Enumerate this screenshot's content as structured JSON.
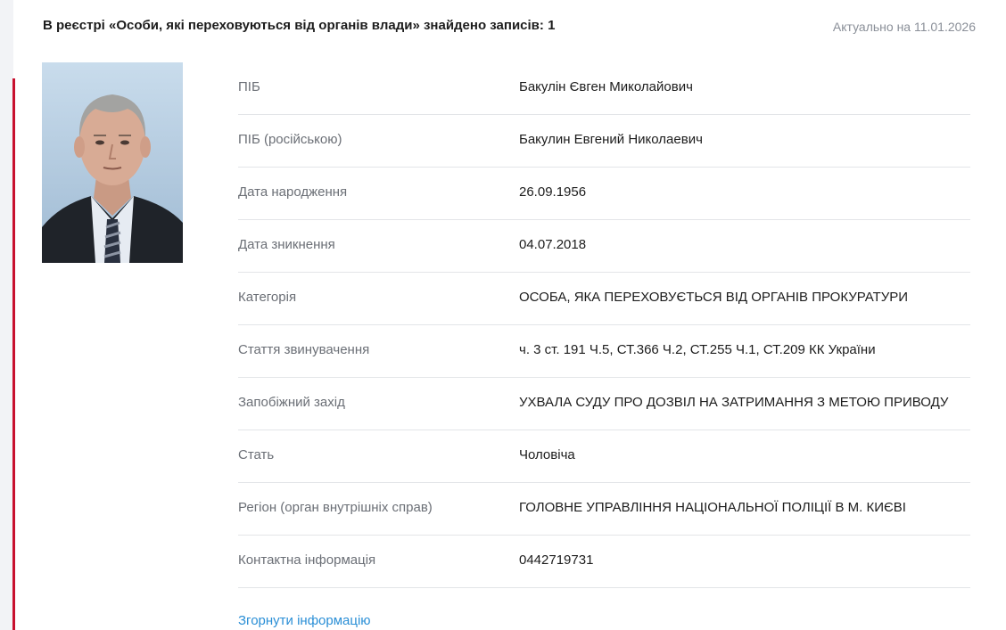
{
  "header": {
    "title": "В реєстрі «Особи, які переховуються від органів влади» знайдено записів: 1",
    "actual_date": "Актуально на 11.01.2026"
  },
  "photo": {
    "icon": "person-photo"
  },
  "details": [
    {
      "label": "ПІБ",
      "value": "Бакулін Євген Миколайович"
    },
    {
      "label": "ПІБ (російською)",
      "value": "Бакулин Евгений Николаевич"
    },
    {
      "label": "Дата народження",
      "value": "26.09.1956"
    },
    {
      "label": "Дата зникнення",
      "value": "04.07.2018"
    },
    {
      "label": "Категорія",
      "value": "ОСОБА, ЯКА ПЕРЕХОВУЄТЬСЯ ВІД ОРГАНІВ ПРОКУРАТУРИ"
    },
    {
      "label": "Стаття звинувачення",
      "value": "ч. 3 ст. 191 Ч.5, СТ.366 Ч.2, СТ.255 Ч.1, СТ.209 КК України"
    },
    {
      "label": "Запобіжний захід",
      "value": "УХВАЛА СУДУ ПРО ДОЗВІЛ НА ЗАТРИМАННЯ З МЕТОЮ ПРИВОДУ"
    },
    {
      "label": "Стать",
      "value": "Чоловіча"
    },
    {
      "label": "Регіон (орган внутрішніх справ)",
      "value": "ГОЛОВНЕ УПРАВЛІННЯ НАЦІОНАЛЬНОЇ ПОЛІЦІЇ В М. КИЄВІ"
    },
    {
      "label": "Контактна інформація",
      "value": "0442719731"
    }
  ],
  "collapse_link": "Згорнути інформацію",
  "colors": {
    "accent": "#c8102e",
    "link": "#2b8fd6",
    "label": "#6b6f76"
  }
}
